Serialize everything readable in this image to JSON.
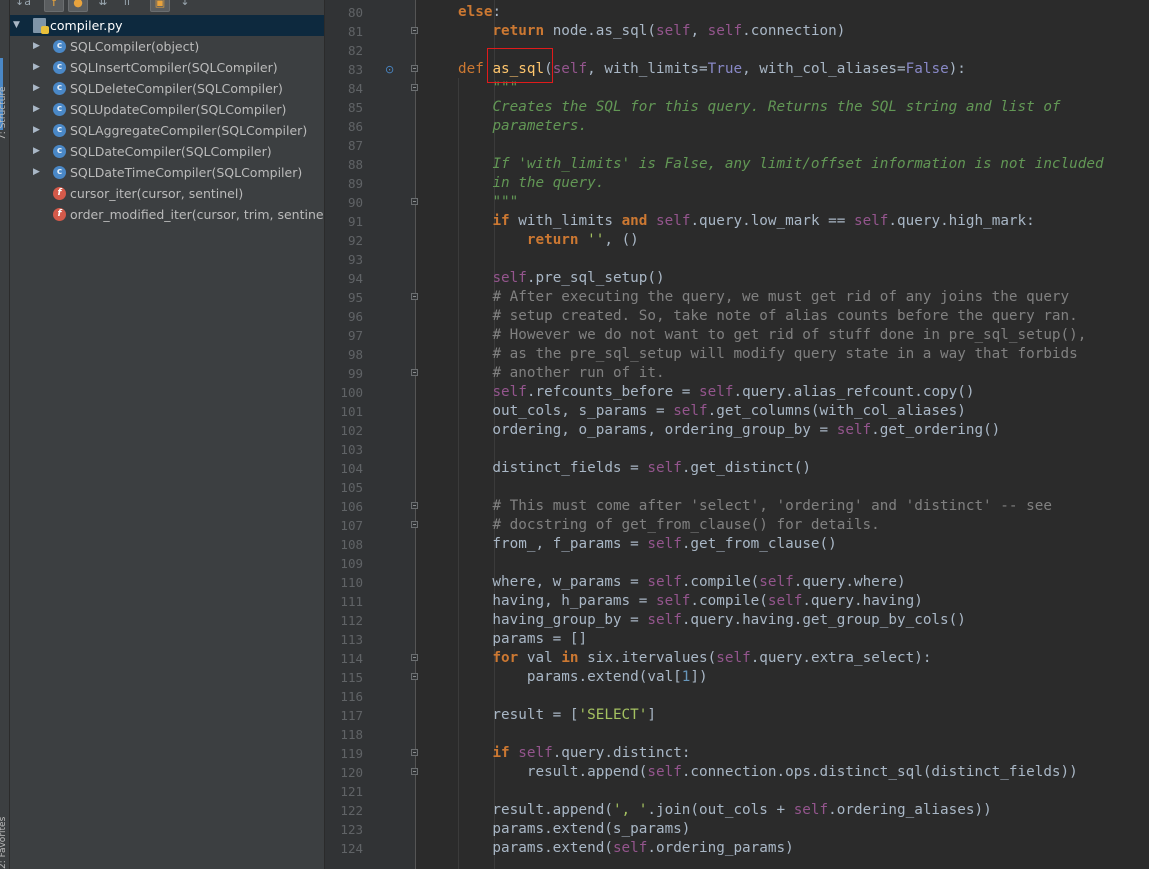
{
  "structure_panel": {
    "strip_top_label": "7: Structure",
    "strip_bottom_label": "2: Favorites",
    "toolbar_icons": [
      "sort-alpha-icon",
      "show-fields-icon",
      "show-inherited-icon",
      "expand-all-icon",
      "collapse-all-icon",
      "autoscroll-icon",
      "sort-down-icon"
    ],
    "file": "compiler.py",
    "items": [
      {
        "kind": "class",
        "label": "SQLCompiler(object)"
      },
      {
        "kind": "class",
        "label": "SQLInsertCompiler(SQLCompiler)"
      },
      {
        "kind": "class",
        "label": "SQLDeleteCompiler(SQLCompiler)"
      },
      {
        "kind": "class",
        "label": "SQLUpdateCompiler(SQLCompiler)"
      },
      {
        "kind": "class",
        "label": "SQLAggregateCompiler(SQLCompiler)"
      },
      {
        "kind": "class",
        "label": "SQLDateCompiler(SQLCompiler)"
      },
      {
        "kind": "class",
        "label": "SQLDateTimeCompiler(SQLCompiler)"
      },
      {
        "kind": "function",
        "label": "cursor_iter(cursor, sentinel)"
      },
      {
        "kind": "function",
        "label": "order_modified_iter(cursor, trim, sentinel)"
      }
    ]
  },
  "editor": {
    "first_line": 80,
    "highlighted_token": "as_sql",
    "lines": [
      "<span class=\"kw\">else</span>:",
      "    <span class=\"kw\">return</span> node.as_sql(<span class=\"self\">self</span>, <span class=\"self\">self</span>.connection)",
      "",
      "<span class=\"def-kw\">def</span> <span class=\"fn\">as_sql</span>(<span class=\"self\">self</span>, with_limits=<span class=\"const\">True</span>, with_col_aliases=<span class=\"const\">False</span>):",
      "    <span class=\"doc\">\"\"\"</span>",
      "    <span class=\"doc\">Creates the SQL for this query. Returns the SQL string and list of</span>",
      "    <span class=\"doc\">parameters.</span>",
      "",
      "    <span class=\"doc\">If 'with_limits' is False, any limit/offset information is not included</span>",
      "    <span class=\"doc\">in the query.</span>",
      "    <span class=\"doc\">\"\"\"</span>",
      "    <span class=\"kw\">if</span> with_limits <span class=\"kw\">and</span> <span class=\"self\">self</span>.query.low_mark == <span class=\"self\">self</span>.query.high_mark:",
      "        <span class=\"kw\">return</span> <span class=\"str\">''</span>, ()",
      "",
      "    <span class=\"self\">self</span>.pre_sql_setup()",
      "    <span class=\"cmt\"># After executing the query, we must get rid of any joins the query</span>",
      "    <span class=\"cmt\"># setup created. So, take note of alias counts before the query ran.</span>",
      "    <span class=\"cmt\"># However we do not want to get rid of stuff done in pre_sql_setup(),</span>",
      "    <span class=\"cmt\"># as the pre_sql_setup will modify query state in a way that forbids</span>",
      "    <span class=\"cmt\"># another run of it.</span>",
      "    <span class=\"self\">self</span>.refcounts_before = <span class=\"self\">self</span>.query.alias_refcount.copy()",
      "    out_cols, s_params = <span class=\"self\">self</span>.get_columns(with_col_aliases)",
      "    ordering, o_params, ordering_group_by = <span class=\"self\">self</span>.get_ordering()",
      "",
      "    distinct_fields = <span class=\"self\">self</span>.get_distinct()",
      "",
      "    <span class=\"cmt\"># This must come after 'select', 'ordering' and 'distinct' -- see</span>",
      "    <span class=\"cmt\"># docstring of get_from_clause() for details.</span>",
      "    from_, f_params = <span class=\"self\">self</span>.get_from_clause()",
      "",
      "    where, w_params = <span class=\"self\">self</span>.compile(<span class=\"self\">self</span>.query.where)",
      "    having, h_params = <span class=\"self\">self</span>.compile(<span class=\"self\">self</span>.query.having)",
      "    having_group_by = <span class=\"self\">self</span>.query.having.get_group_by_cols()",
      "    params = []",
      "    <span class=\"kw\">for</span> val <span class=\"kw\">in</span> six.itervalues(<span class=\"self\">self</span>.query.extra_select):",
      "        params.extend(val[<span class=\"num\">1</span>])",
      "",
      "    result = [<span class=\"str\">'SELECT'</span>]",
      "",
      "    <span class=\"kw\">if</span> <span class=\"self\">self</span>.query.distinct:",
      "        result.append(<span class=\"self\">self</span>.connection.ops.distinct_sql(distinct_fields))",
      "",
      "    result.append(<span class=\"str\">', '</span>.join(out_cols + <span class=\"self\">self</span>.ordering_aliases))",
      "    params.extend(s_params)",
      "    params.extend(<span class=\"self\">self</span>.ordering_params)"
    ],
    "fold_lines": [
      81,
      83,
      84,
      90,
      95,
      99,
      106,
      107,
      114,
      115,
      119,
      120
    ],
    "override_marker_line": 83
  }
}
